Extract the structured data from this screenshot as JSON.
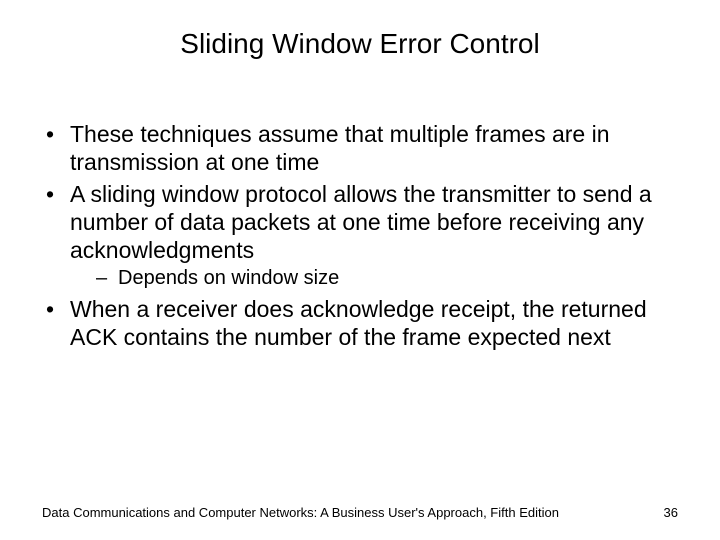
{
  "title": "Sliding Window Error Control",
  "bullets": {
    "b1": "These techniques assume that multiple frames are in transmission at one time",
    "b2": "A sliding window protocol allows the transmitter to send a number of data packets at one time before receiving any acknowledgments",
    "b2_sub1": "Depends on window size",
    "b3": "When a receiver does acknowledge receipt, the returned ACK contains the number of the frame expected next"
  },
  "footer": {
    "source": "Data Communications and Computer Networks: A Business User's Approach, Fifth Edition",
    "page": "36"
  }
}
